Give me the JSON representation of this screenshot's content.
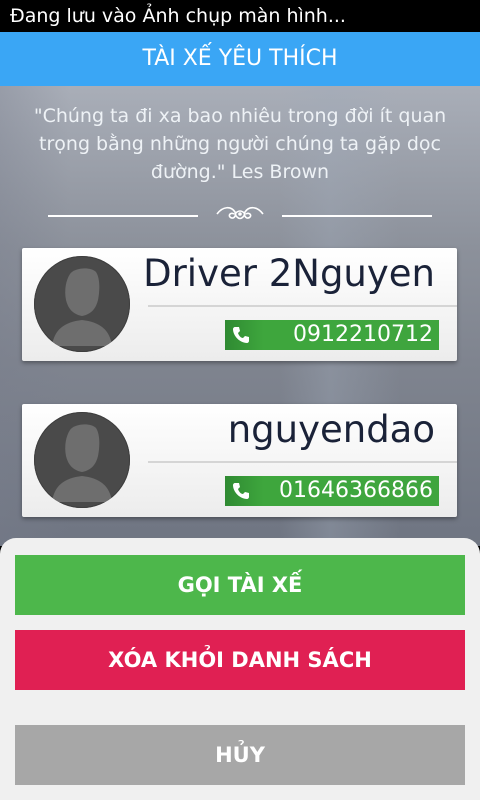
{
  "status_bar": {
    "text": "Đang lưu vào Ảnh chụp màn hình..."
  },
  "header": {
    "title": "TÀI XẾ YÊU THÍCH"
  },
  "quote": {
    "text": "\"Chúng ta đi xa bao nhiêu trong đời ít quan trọng bằng những người chúng ta gặp dọc đường.\" Les Brown"
  },
  "drivers": [
    {
      "name": "Driver 2Nguyen",
      "phone": "0912210712",
      "avatar_icon": "person-silhouette-icon",
      "phone_icon": "phone-icon"
    },
    {
      "name": "nguyendao",
      "phone": "01646366866",
      "avatar_icon": "person-silhouette-icon",
      "phone_icon": "phone-icon"
    }
  ],
  "actions": {
    "call_label": "GỌI TÀI XẾ",
    "remove_label": "XÓA KHỎI DANH SÁCH",
    "cancel_label": "HỦY"
  },
  "colors": {
    "header": "#3aa6f5",
    "call": "#4db74b",
    "remove": "#e02053",
    "cancel": "#a7a7a7",
    "phone_badge": "#3fa53e"
  }
}
